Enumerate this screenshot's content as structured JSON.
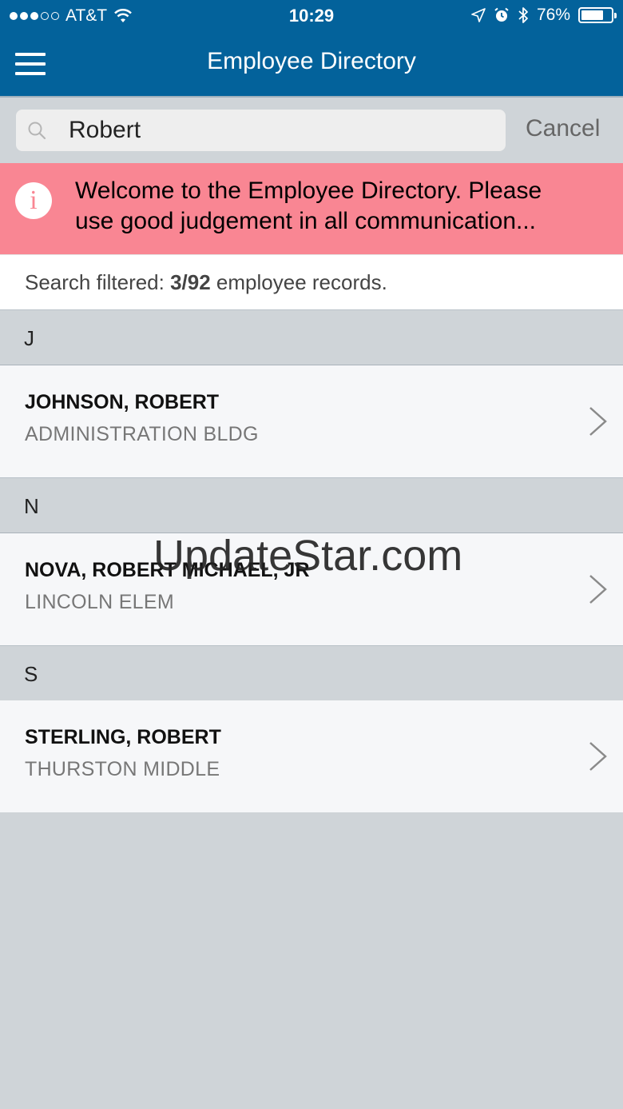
{
  "status_bar": {
    "carrier": "AT&T",
    "time": "10:29",
    "battery": "76%",
    "battery_level": 0.76
  },
  "header": {
    "title": "Employee Directory"
  },
  "search": {
    "value": "Robert",
    "cancel_label": "Cancel"
  },
  "banner": {
    "icon": "info-icon",
    "line1": "Welcome to the Employee Directory. Please",
    "line2": "use good judgement in all communication..."
  },
  "filter": {
    "prefix": "Search filtered: ",
    "count": "3/92",
    "suffix": " employee records."
  },
  "sections": [
    {
      "letter": "J",
      "name": "JOHNSON, ROBERT",
      "location": "ADMINISTRATION BLDG"
    },
    {
      "letter": "N",
      "name": "NOVA, ROBERT MICHAEL, JR",
      "location": "LINCOLN ELEM"
    },
    {
      "letter": "S",
      "name": "STERLING, ROBERT",
      "location": "THURSTON MIDDLE"
    }
  ],
  "watermark": "UpdateStar.com",
  "colors": {
    "header_bg": "#03629b",
    "banner_bg": "#f98693",
    "background": "#cfd4d8"
  }
}
